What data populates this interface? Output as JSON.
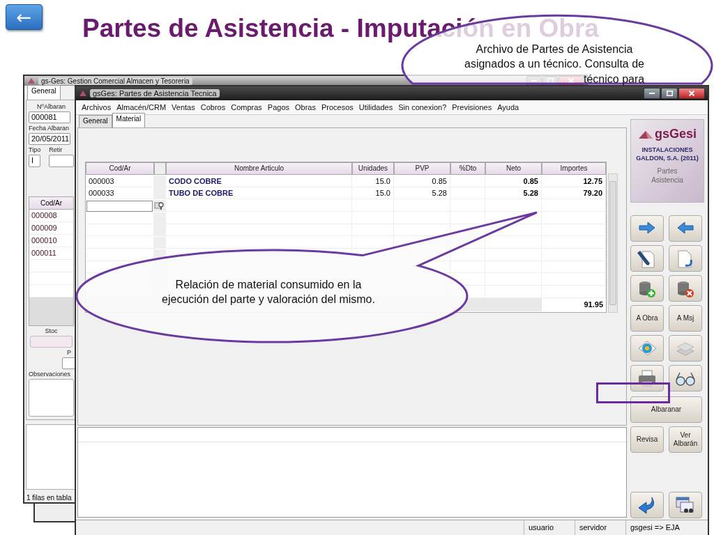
{
  "slide": {
    "back_button": "←",
    "title": "Partes de Asistencia - Imputación en Obra"
  },
  "callouts": [
    {
      "kind": "ellipse",
      "text": "Archivo de Partes de Asistencia asignados a un técnico. Consulta de",
      "cut_text": "técnico para"
    },
    {
      "kind": "tail",
      "text": "Relación de material consumido en la ejecución del parte y valoración del mismo."
    }
  ],
  "back_window": {
    "title": "gs-Ges: Gestion Comercial Almacen y Tesoreria",
    "tabs": [
      {
        "label": "General",
        "selected": true
      }
    ],
    "albaran_label": "NºAlbaran",
    "albaran": "000081",
    "fecha_label": "Fecha Albaran",
    "fecha": "20/05/2011",
    "tipo_label": "Tipo",
    "tipo": "I",
    "retira_label": "Retir",
    "table": {
      "columns": [
        "Cod/Ar"
      ],
      "rows": [
        "000008",
        "000009",
        "000010",
        "000011"
      ]
    },
    "stock_label": "Stoc",
    "field_label": "P",
    "observaciones_label": "Observaciones",
    "status": "1 filas en tabla"
  },
  "main_window": {
    "title": "gsGes: Partes de Asistencia Tecnica",
    "menu": [
      "Archivos",
      "Almacén/CRM",
      "Ventas",
      "Cobros",
      "Compras",
      "Pagos",
      "Obras",
      "Procesos",
      "Utilidades",
      "Sin conexion?",
      "Previsiones",
      "Ayuda"
    ],
    "tabs": [
      {
        "label": "General",
        "selected": false
      },
      {
        "label": "Material",
        "selected": true
      }
    ],
    "table": {
      "columns": [
        "Cod/Ar",
        "Nombre Articulo",
        "Unidades",
        "PVP",
        "%Dto",
        "Neto",
        "Importes"
      ],
      "rows": [
        {
          "cod": "000003",
          "nombre": "CODO COBRE",
          "unidades": "15.0",
          "pvp": "0.85",
          "neto": "0.85",
          "importe": "12.75"
        },
        {
          "cod": "000033",
          "nombre": "TUBO DE COBRE",
          "unidades": "15.0",
          "pvp": "5.28",
          "neto": "5.28",
          "importe": "79.20"
        }
      ],
      "total": "91.95"
    },
    "brand": {
      "name": "gsGesi",
      "company": "INSTALACIONES GALDON, S.A. (2011)",
      "module": "Partes Asistencia"
    },
    "side_buttons": [
      {
        "kind": "icon"
      },
      {
        "kind": "icon"
      },
      {
        "kind": "icon"
      },
      {
        "kind": "icon"
      },
      {
        "kind": "icon"
      },
      {
        "kind": "icon"
      },
      {
        "kind": "text",
        "label": "A Obra"
      },
      {
        "kind": "text",
        "label": "A Msj"
      },
      {
        "kind": "icon"
      },
      {
        "kind": "icon"
      },
      {
        "kind": "icon"
      },
      {
        "kind": "icon"
      },
      {
        "kind": "wide",
        "label": "Albaranar"
      },
      {
        "kind": "text",
        "label": "Revisa"
      },
      {
        "kind": "text",
        "label": "Ver Albarán"
      }
    ],
    "bottom_buttons": [
      {
        "kind": "icon"
      },
      {
        "kind": "icon"
      }
    ],
    "status_bar": [
      "usuario",
      "servidor",
      "gsgesi => EJA"
    ]
  }
}
